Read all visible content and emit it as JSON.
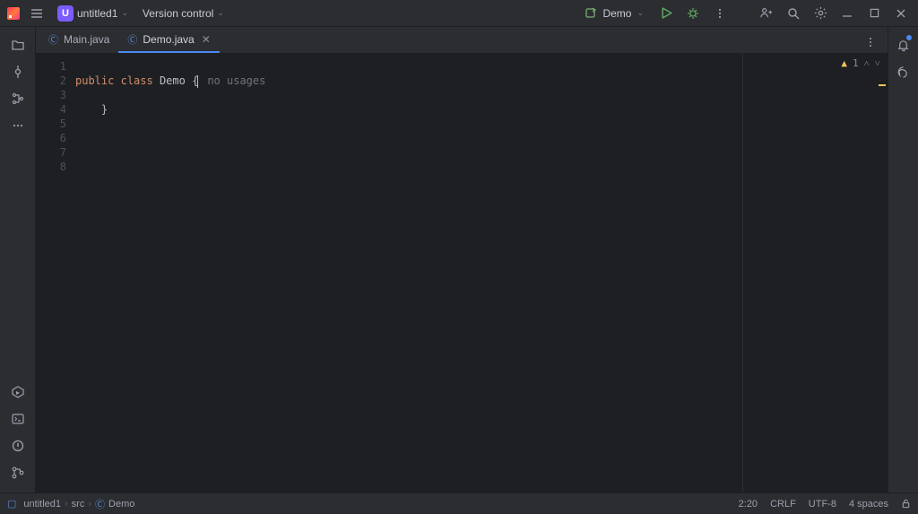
{
  "titlebar": {
    "project_initial": "U",
    "project_name": "untitled1",
    "vcs_label": "Version control",
    "run_config": "Demo"
  },
  "left_rail": {
    "items": [
      "project",
      "commit",
      "structure",
      "more"
    ],
    "bottom_items": [
      "services",
      "terminal",
      "problems",
      "git"
    ]
  },
  "tabs": [
    {
      "label": "Main.java",
      "active": false,
      "closeable": false
    },
    {
      "label": "Demo.java",
      "active": true,
      "closeable": true
    }
  ],
  "editor": {
    "gutter": [
      "1",
      "2",
      "3",
      "4",
      "5",
      "6",
      "7",
      "8"
    ],
    "lines": {
      "l2_kw1": "public",
      "l2_kw2": "class",
      "l2_name": "Demo",
      "l2_brace": "{",
      "l2_hint": "no usages",
      "l4": "    }"
    },
    "inspection": {
      "count": "1"
    }
  },
  "breadcrumb": {
    "p1": "untitled1",
    "p2": "src",
    "p3": "Demo"
  },
  "status": {
    "pos": "2:20",
    "eol": "CRLF",
    "enc": "UTF-8",
    "indent": "4 spaces"
  }
}
